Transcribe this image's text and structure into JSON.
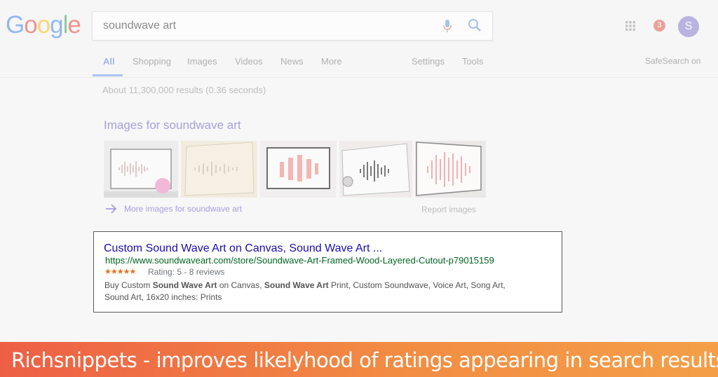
{
  "header": {
    "logo_letters": [
      "G",
      "o",
      "o",
      "g",
      "l",
      "e"
    ],
    "logo_colors": [
      "#4285f4",
      "#ea4335",
      "#fbbc05",
      "#4285f4",
      "#34a853",
      "#ea4335"
    ],
    "search_query": "soundwave art",
    "notification_count": "3",
    "avatar_initial": "S"
  },
  "tabs": [
    {
      "label": "All",
      "active": true
    },
    {
      "label": "Shopping"
    },
    {
      "label": "Images"
    },
    {
      "label": "Videos"
    },
    {
      "label": "News"
    },
    {
      "label": "More"
    },
    {
      "label": "Settings"
    },
    {
      "label": "Tools"
    }
  ],
  "safesearch": "SafeSearch on",
  "result_stats": "About 11,300,000 results (0.36 seconds)",
  "images_section": {
    "heading": "Images for soundwave art",
    "more_link": "More images for soundwave art",
    "report": "Report images"
  },
  "result": {
    "title": "Custom Sound Wave Art on Canvas, Sound Wave Art ...",
    "url": "https://www.soundwaveart.com/store/Soundwave-Art-Framed-Wood-Layered-Cutout-p79015159",
    "stars": "★★★★★",
    "rating": "Rating: 5 - 8 reviews",
    "snippet_parts": [
      {
        "text": "Buy Custom ",
        "bold": false
      },
      {
        "text": "Sound Wave Art",
        "bold": true
      },
      {
        "text": " on Canvas, ",
        "bold": false
      },
      {
        "text": "Sound Wave Art",
        "bold": true
      },
      {
        "text": " Print, Custom Soundwave, Voice Art, Song Art, Sound Art, 16x20 inches: Prints",
        "bold": false
      }
    ]
  },
  "banner": {
    "text": "Richsnippets - improves likelyhood of ratings appearing in search results"
  },
  "colors": {
    "result_title": "#1a0dab",
    "result_url": "#006621",
    "stars": "#e7711b",
    "banner_start": "#ed5f45",
    "banner_end": "#f49f48"
  }
}
